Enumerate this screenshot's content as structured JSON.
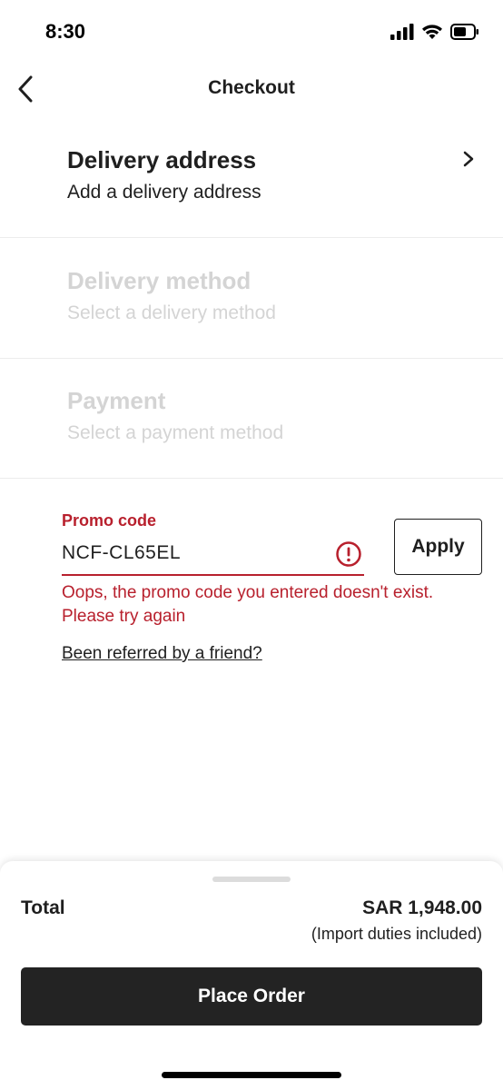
{
  "status_bar": {
    "time": "8:30",
    "icons": [
      "signal-icon",
      "wifi-icon",
      "battery-icon"
    ]
  },
  "header": {
    "title": "Checkout",
    "back_icon": "chevron-left-icon"
  },
  "sections": [
    {
      "title": "Delivery address",
      "subtitle": "Add a delivery address",
      "state": "active",
      "icon": "chevron-right-icon"
    },
    {
      "title": "Delivery method",
      "subtitle": "Select a delivery method",
      "state": "disabled"
    },
    {
      "title": "Payment",
      "subtitle": "Select a payment method",
      "state": "disabled"
    }
  ],
  "promo": {
    "label": "Promo code",
    "value": "NCF-CL65EL",
    "error_icon": "alert-circle-icon",
    "apply_label": "Apply",
    "error_line1": "Oops, the promo code you entered doesn't exist.",
    "error_line2": "Please try again",
    "referral_link": "Been referred by a friend?"
  },
  "summary": {
    "total_label": "Total",
    "total_amount": "SAR 1,948.00",
    "total_note": "(Import duties included)",
    "place_order_label": "Place Order"
  },
  "colors": {
    "error": "#b8202d",
    "text": "#1f1f1f",
    "disabled_text": "#d4d4d4",
    "primary_button": "#232323"
  }
}
